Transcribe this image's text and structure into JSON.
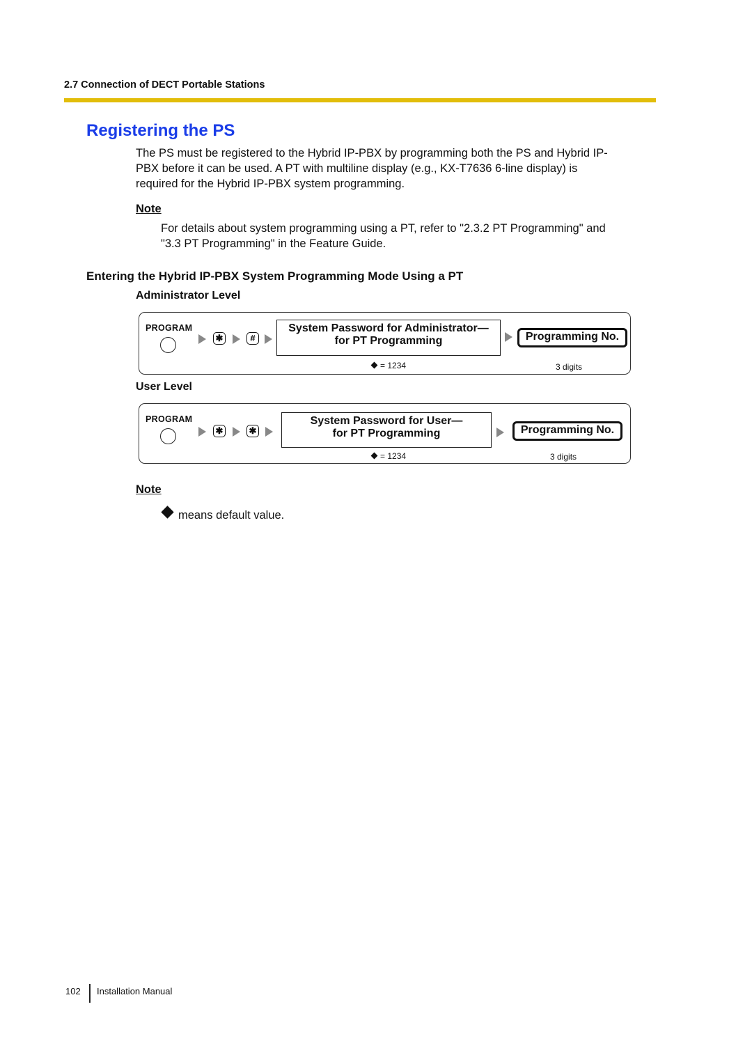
{
  "header": {
    "section": "2.7 Connection of DECT Portable Stations",
    "rule_color": "#e2bd0a"
  },
  "title": {
    "text": "Registering the PS",
    "color": "#1a3de8"
  },
  "intro": {
    "lines": [
      "The PS must be registered to the Hybrid IP-PBX by programming both the PS and Hybrid IP-",
      "PBX before it can be used. A PT with multiline display (e.g., KX-T7636 6-line display) is",
      "required for the Hybrid IP-PBX system programming."
    ]
  },
  "note1": {
    "label": "Note",
    "lines": [
      "For details about system programming using a PT, refer to \"2.3.2 PT Programming\" and",
      "\"3.3 PT Programming\" in the Feature Guide."
    ]
  },
  "subsection": {
    "title": "Entering the Hybrid IP-PBX System Programming Mode Using a PT"
  },
  "flows": [
    {
      "label": "Administrator Level",
      "program_label": "PROGRAM",
      "keys": [
        "✱",
        "#"
      ],
      "key_icons": [
        "asterisk-key-icon",
        "hash-key-icon"
      ],
      "password_line1": "System Password for Administrator—",
      "password_line2": "for PT Programming",
      "default_value": "= 1234",
      "programming_no": "Programming No.",
      "digits": "3 digits"
    },
    {
      "label": "User Level",
      "program_label": "PROGRAM",
      "keys": [
        "✱",
        "✱"
      ],
      "key_icons": [
        "asterisk-key-icon",
        "asterisk-key-icon"
      ],
      "password_line1": "System Password for User—",
      "password_line2": "for PT Programming",
      "default_value": "= 1234",
      "programming_no": "Programming No.",
      "digits": "3 digits"
    }
  ],
  "note2": {
    "label": "Note",
    "text": "means default value."
  },
  "footer": {
    "page_number": "102",
    "manual_title": "Installation Manual"
  }
}
